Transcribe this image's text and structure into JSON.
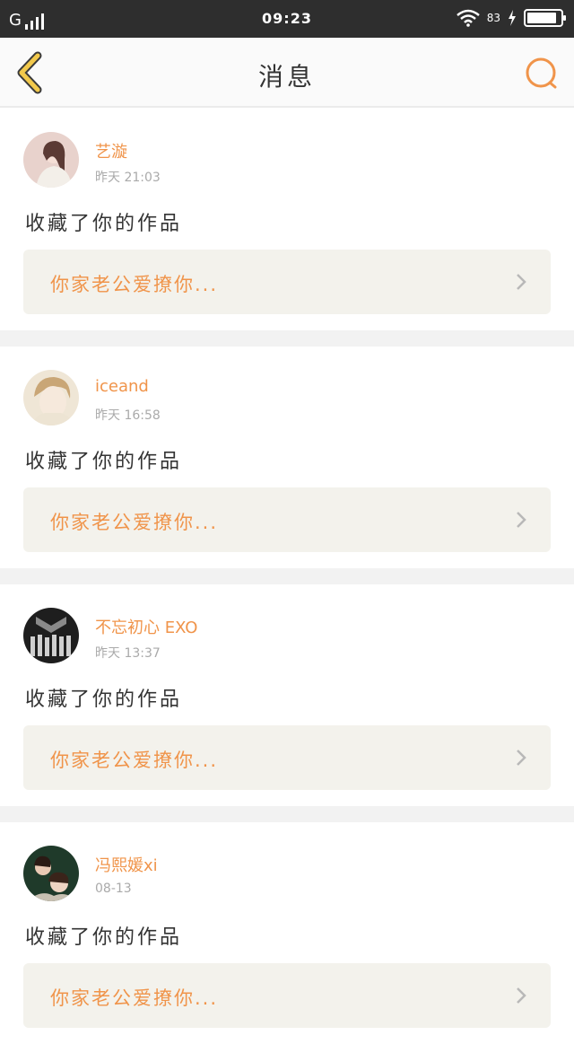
{
  "status_bar": {
    "carrier": "G",
    "time": "09:23",
    "battery_percent": "83",
    "battery_level": 0.9
  },
  "header": {
    "title": "消息",
    "back_icon": "chevron-left-icon",
    "search_icon": "search-icon"
  },
  "colors": {
    "accent": "#f0944a",
    "back_icon": "#f2c94c",
    "card_bg": "#f3f2ec",
    "separator": "#f2f2f2"
  },
  "messages": [
    {
      "user": "艺漩",
      "time": "昨天  21:03",
      "action": "收藏了你的作品",
      "work_title": "你家老公爱撩你..."
    },
    {
      "user": "iceand",
      "time": "昨天  16:58",
      "action": "收藏了你的作品",
      "work_title": "你家老公爱撩你..."
    },
    {
      "user": "不忘初心 EXO",
      "time": "昨天  13:37",
      "action": "收藏了你的作品",
      "work_title": "你家老公爱撩你..."
    },
    {
      "user": "冯熙媛xi",
      "time": "08-13",
      "action": "收藏了你的作品",
      "work_title": "你家老公爱撩你..."
    }
  ]
}
